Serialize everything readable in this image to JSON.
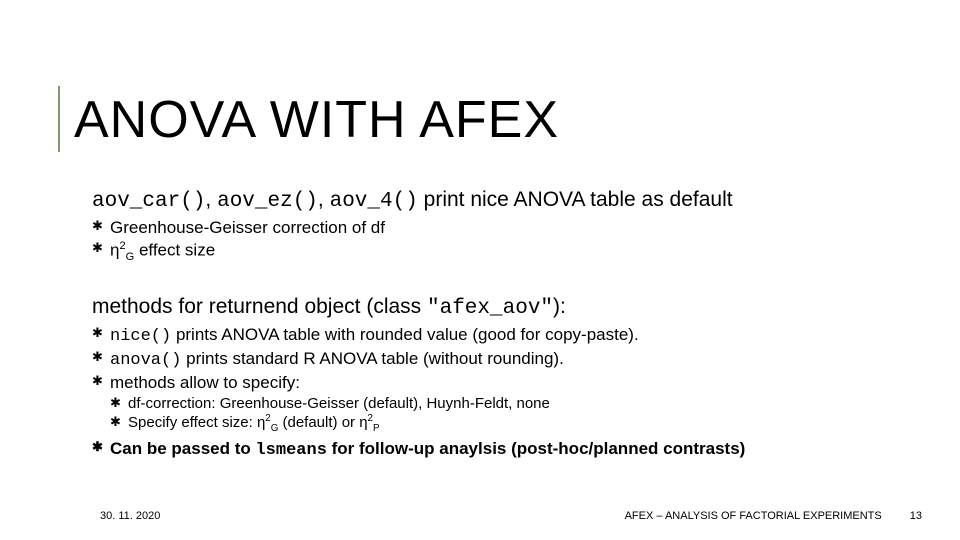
{
  "title": "ANOVA WITH AFEX",
  "line1": {
    "fn1": "aov_car()",
    "sep1": ", ",
    "fn2": "aov_ez()",
    "sep2": ", ",
    "fn3": "aov_4()",
    "rest": " print nice ANOVA table as default"
  },
  "b1": "Greenhouse-Geisser correction of df",
  "b2": {
    "eta": "η",
    "sup": "2",
    "sub": "G",
    "rest": " effect size"
  },
  "line2": {
    "pre": "methods for returnend object (class ",
    "cls": "\"afex_aov\"",
    "post": "):"
  },
  "m1": {
    "fn": "nice()",
    "rest": " prints ANOVA table with rounded value (good for copy-paste)."
  },
  "m2": {
    "fn": "anova()",
    "rest": " prints standard R ANOVA table (without rounding)."
  },
  "m3": "methods allow to specify:",
  "n1": "df-correction: Greenhouse-Geisser (default), Huynh-Feldt, none",
  "n2": {
    "pre": "Specify effect size: ",
    "eta1": "η",
    "sup1": "2",
    "sub1": "G",
    "mid": " (default) or ",
    "eta2": "η",
    "sup2": "2",
    "sub2": "P"
  },
  "m4": {
    "pre": "Can be passed to ",
    "fn": "lsmeans",
    "post": " for follow-up anaylsis (post-hoc/planned contrasts)"
  },
  "footer": {
    "date": "30. 11. 2020",
    "source": "AFEX – ANALYSIS OF FACTORIAL EXPERIMENTS",
    "page": "13"
  }
}
